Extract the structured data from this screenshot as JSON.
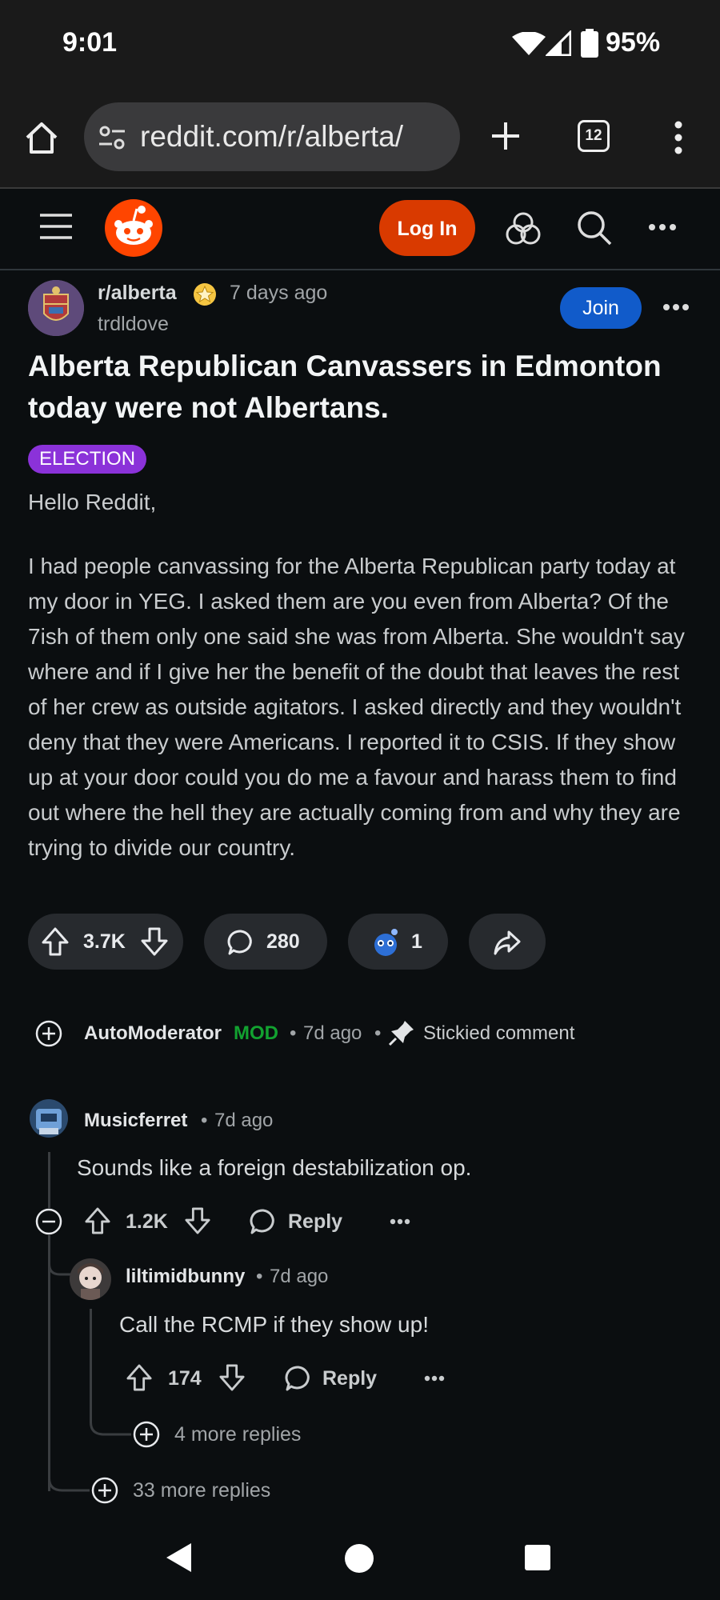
{
  "status_bar": {
    "time": "9:01",
    "battery": "95%",
    "icons": [
      "wifi-icon",
      "signal-icon",
      "battery-icon"
    ]
  },
  "browser": {
    "url": "reddit.com/r/alberta/",
    "tab_count": "12"
  },
  "reddit_header": {
    "login_label": "Log In"
  },
  "post": {
    "subreddit": "r/alberta",
    "time": "7 days ago",
    "author": "trdldove",
    "join_label": "Join",
    "title": "Alberta Republican Canvassers in Edmonton today were not Albertans.",
    "flair": "ELECTION",
    "greeting": "Hello Reddit,",
    "body": "I had people canvassing for the Alberta Republican party today at my door in YEG. I asked them are you even from Alberta? Of the 7ish of them only one said she was from Alberta. She wouldn't say where and if I give her the benefit of the doubt that leaves the rest of her crew as outside agitators. I asked directly and they wouldn't deny that they were Americans. I reported it to CSIS. If they show up at your door could you do me a favour and harass them to find out where the hell they are actually coming from and why they are trying to divide our country.",
    "upvotes": "3.7K",
    "comments": "280",
    "awards": "1"
  },
  "comments": {
    "automod": {
      "user": "AutoModerator",
      "badge": "MOD",
      "time": "7d ago",
      "sticky": "Stickied comment"
    },
    "c1": {
      "user": "Musicferret",
      "time": "7d ago",
      "text": "Sounds like a foreign destabilization op.",
      "votes": "1.2K",
      "reply": "Reply"
    },
    "c2": {
      "user": "liltimidbunny",
      "time": "7d ago",
      "text": "Call the RCMP if they show up!",
      "votes": "174",
      "reply": "Reply"
    },
    "more_nested": "4 more replies",
    "more_top": "33 more replies"
  },
  "colors": {
    "accent": "#d93a00",
    "join": "#115bca",
    "flair": "#8b32d9",
    "mod": "#12a230"
  }
}
